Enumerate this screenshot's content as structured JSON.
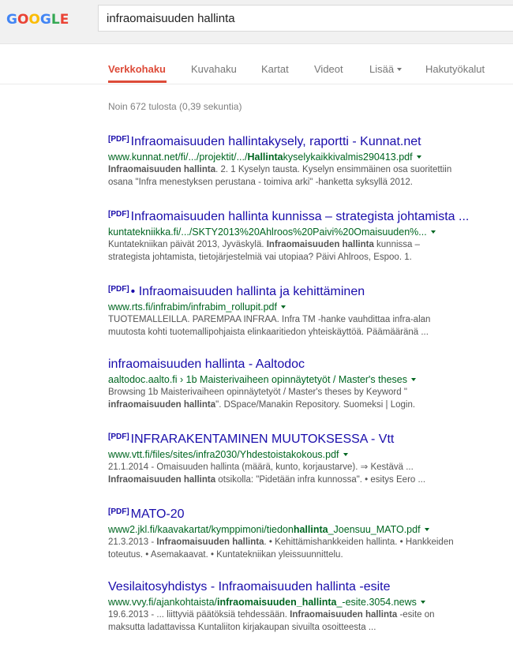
{
  "search": {
    "query": "infraomaisuuden hallinta"
  },
  "logo": {
    "letters": [
      "G",
      "O",
      "O",
      "G",
      "L",
      "E"
    ],
    "colors": [
      "#4285f4",
      "#ea4335",
      "#fbbc05",
      "#4285f4",
      "#34a853",
      "#ea4335"
    ]
  },
  "tabs": [
    {
      "label": "Verkkohaku",
      "active": true
    },
    {
      "label": "Kuvahaku"
    },
    {
      "label": "Kartat"
    },
    {
      "label": "Videot"
    },
    {
      "label": "Lisää"
    },
    {
      "label": "Hakutyökalut"
    }
  ],
  "stats": "Noin 672 tulosta (0,39 sekuntia)",
  "colors": {
    "link": "#1a0dab",
    "url": "#006621",
    "accent": "#dd4b39",
    "snippet": "#545454"
  },
  "results": [
    {
      "pdf": "[PDF]",
      "title": "Infraomaisuuden hallintakysely, raportti - Kunnat.net",
      "url": [
        "www.kunnat.net/fi/.../projektit/.../",
        "Hallinta",
        "kyselykaikkivalmis290413.pdf"
      ],
      "snippet": [
        [
          "Infraomaisuuden hallinta",
          ". 2. 1 Kyselyn tausta. Kyselyn ensimmäinen osa suoritettiin"
        ],
        [
          "",
          "osana \"Infra menestyksen perustana - toimiva arki\" -hanketta syksyllä 2012."
        ]
      ]
    },
    {
      "pdf": "[PDF]",
      "title": "Infraomaisuuden hallinta kunnissa – strategista johtamista ...",
      "url": [
        "kuntatekniikka.fi/.../SKTY2013%20Ahlroos%20Paivi%20Omaisuuden%...",
        "",
        ""
      ],
      "snippet": [
        [
          "",
          "Kuntatekniikan päivät 2013, Jyväskylä. ",
          "Infraomaisuuden hallinta",
          " kunnissa –"
        ],
        [
          "",
          "strategista johtamista, tietojärjestelmiä vai utopiaa? Päivi Ahlroos, Espoo. 1."
        ]
      ]
    },
    {
      "pdf": "[PDF]",
      "title": "• Infraomaisuuden hallinta ja kehittäminen",
      "url": [
        "www.rts.fi/infrabim/infrabim_rollupit.pdf",
        "",
        ""
      ],
      "snippet": [
        [
          "",
          "TUOTEMALLEILLA. PAREMPAA INFRAA. Infra TM -hanke vauhdittaa infra-alan"
        ],
        [
          "",
          "muutosta kohti tuotemallipohjaista elinkaaritiedon yhteiskäyttöä. Päämääränä ..."
        ]
      ]
    },
    {
      "pdf": "",
      "title": "infraomaisuuden hallinta - Aaltodoc",
      "url": [
        "aaltodoc.aalto.fi › 1b Maisterivaiheen opinnäytetyöt / Master's theses",
        "",
        ""
      ],
      "snippet": [
        [
          "",
          "Browsing 1b Maisterivaiheen opinnäytetyöt / Master's theses by Keyword \""
        ],
        [
          "infraomaisuuden hallinta",
          "\". DSpace/Manakin Repository. Suomeksi | Login."
        ]
      ]
    },
    {
      "pdf": "[PDF]",
      "title": "INFRARAKENTAMINEN MUUTOKSESSA - Vtt",
      "url": [
        "www.vtt.fi/files/sites/infra2030/Yhdestoistakokous.pdf",
        "",
        ""
      ],
      "snippet": [
        [
          "",
          "21.1.2014 - Omaisuuden hallinta (määrä, kunto, korjaustarve). ⇒ Kestävä ..."
        ],
        [
          "Infraomaisuuden hallinta",
          " otsikolla: \"Pidetään infra kunnossa\". • esitys Eero ..."
        ]
      ]
    },
    {
      "pdf": "[PDF]",
      "title": "MATO-20",
      "url": [
        "www2.jkl.fi/kaavakartat/kymppimoni/tiedon",
        "hallinta",
        "_Joensuu_MATO.pdf"
      ],
      "snippet": [
        [
          "",
          "21.3.2013 - ",
          "Infraomaisuuden hallinta",
          ". • Kehittämishankkeiden hallinta. • Hankkeiden"
        ],
        [
          "",
          "toteutus. • Asemakaavat. • Kuntatekniikan yleissuunnittelu."
        ]
      ]
    },
    {
      "pdf": "",
      "title": "Vesilaitosyhdistys - Infraomaisuuden hallinta -esite",
      "url": [
        "www.vvy.fi/ajankohtaista/",
        "infraomaisuuden_hallinta",
        "_-esite.3054.news"
      ],
      "snippet": [
        [
          "",
          "19.6.2013 - ... liittyviä päätöksiä tehdessään. ",
          "Infraomaisuuden hallinta",
          " -esite on"
        ],
        [
          "",
          "maksutta ladattavissa Kuntaliiton kirjakaupan sivuilta osoitteesta ..."
        ]
      ]
    }
  ]
}
